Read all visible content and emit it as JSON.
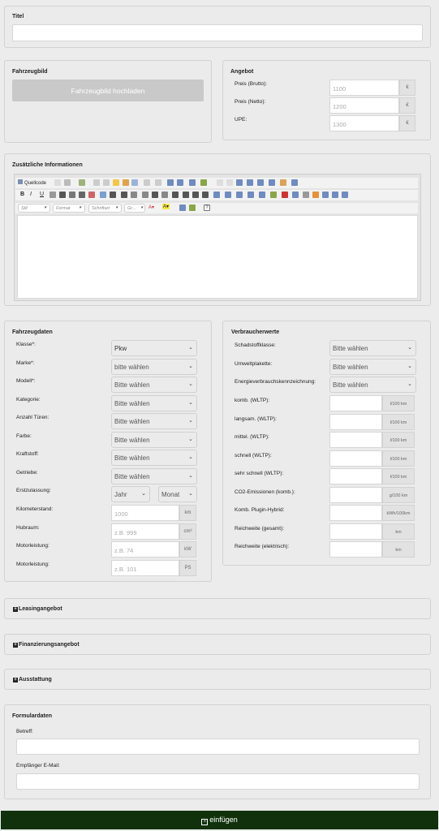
{
  "titel": {
    "label": "Titel"
  },
  "image": {
    "label": "Fahrzeugbild",
    "button": "Fahrzeugbild hochladen"
  },
  "angebot": {
    "label": "Angebot",
    "rows": [
      {
        "label": "Preis (Brutto):",
        "placeholder": "1100",
        "unit": "€"
      },
      {
        "label": "Preis (Netto):",
        "placeholder": "1200",
        "unit": "€"
      },
      {
        "label": "UPE:",
        "placeholder": "1300",
        "unit": "€"
      }
    ]
  },
  "zusatz": {
    "label": "Zusätzliche Informationen",
    "source": "Quellcode",
    "style": "Stil",
    "format": "Format",
    "font": "Schriftart",
    "size": "Gr..."
  },
  "fahrzeugdaten": {
    "label": "Fahrzeugdaten",
    "selects": [
      {
        "label": "Klasse*:",
        "value": "Pkw"
      },
      {
        "label": "Marke*:",
        "value": "bitte wählen"
      },
      {
        "label": "Modell*:",
        "value": "Bitte wählen"
      },
      {
        "label": "Kategorie:",
        "value": "Bitte wählen"
      },
      {
        "label": "Anzahl Türen:",
        "value": "Bitte wählen"
      },
      {
        "label": "Farbe:",
        "value": "Bitte wählen"
      },
      {
        "label": "Kraftstoff:",
        "value": "Bitte wählen"
      },
      {
        "label": "Getriebe:",
        "value": "Bitte wählen"
      }
    ],
    "ez": {
      "label": "Erstzulassung:",
      "year": "Jahr",
      "month": "Monat"
    },
    "inputs": [
      {
        "label": "Kilometerstand:",
        "placeholder": "1000",
        "unit": "km"
      },
      {
        "label": "Hubraum:",
        "placeholder": "z.B. 999",
        "unit": "cm³"
      },
      {
        "label": "Motorleistung:",
        "placeholder": "z.B. 74",
        "unit": "kW"
      },
      {
        "label": "Motorleistung:",
        "placeholder": "z.B. 101",
        "unit": "PS"
      }
    ]
  },
  "verbraucher": {
    "label": "Verbraucherwerte",
    "selects": [
      {
        "label": "Schadstoffklasse:",
        "value": "Bitte wählen"
      },
      {
        "label": "Umweltplakette:",
        "value": "Bitte wählen"
      },
      {
        "label": "Energieverbrauchskennzeichnung:",
        "value": "Bitte wählen"
      }
    ],
    "inputs": [
      {
        "label": "komb. (WLTP):",
        "unit": "l/100 km"
      },
      {
        "label": "langsam. (WLTP):",
        "unit": "l/100 km"
      },
      {
        "label": "mittel. (WLTP):",
        "unit": "l/100 km"
      },
      {
        "label": "schnell (WLTP):",
        "unit": "l/100 km"
      },
      {
        "label": "sehr schnell (WLTP):",
        "unit": "l/100 km"
      },
      {
        "label": "CO2-Emissionen (komb.):",
        "unit": "g/100 km"
      },
      {
        "label": "Komb. Plugin-Hybrid:",
        "unit": "kWh/100km"
      },
      {
        "label": "Reichweite (gesamt):",
        "unit": "km"
      },
      {
        "label": "Reichweite (elektrisch):",
        "unit": "km"
      }
    ]
  },
  "sections": [
    "Leasingangebot",
    "Finanzierungsangebot",
    "Ausstattung"
  ],
  "formular": {
    "label": "Formulardaten",
    "betreff": "Betreff:",
    "email": "Empfänger E-Mail:"
  },
  "submit": {
    "label": "einfügen"
  }
}
